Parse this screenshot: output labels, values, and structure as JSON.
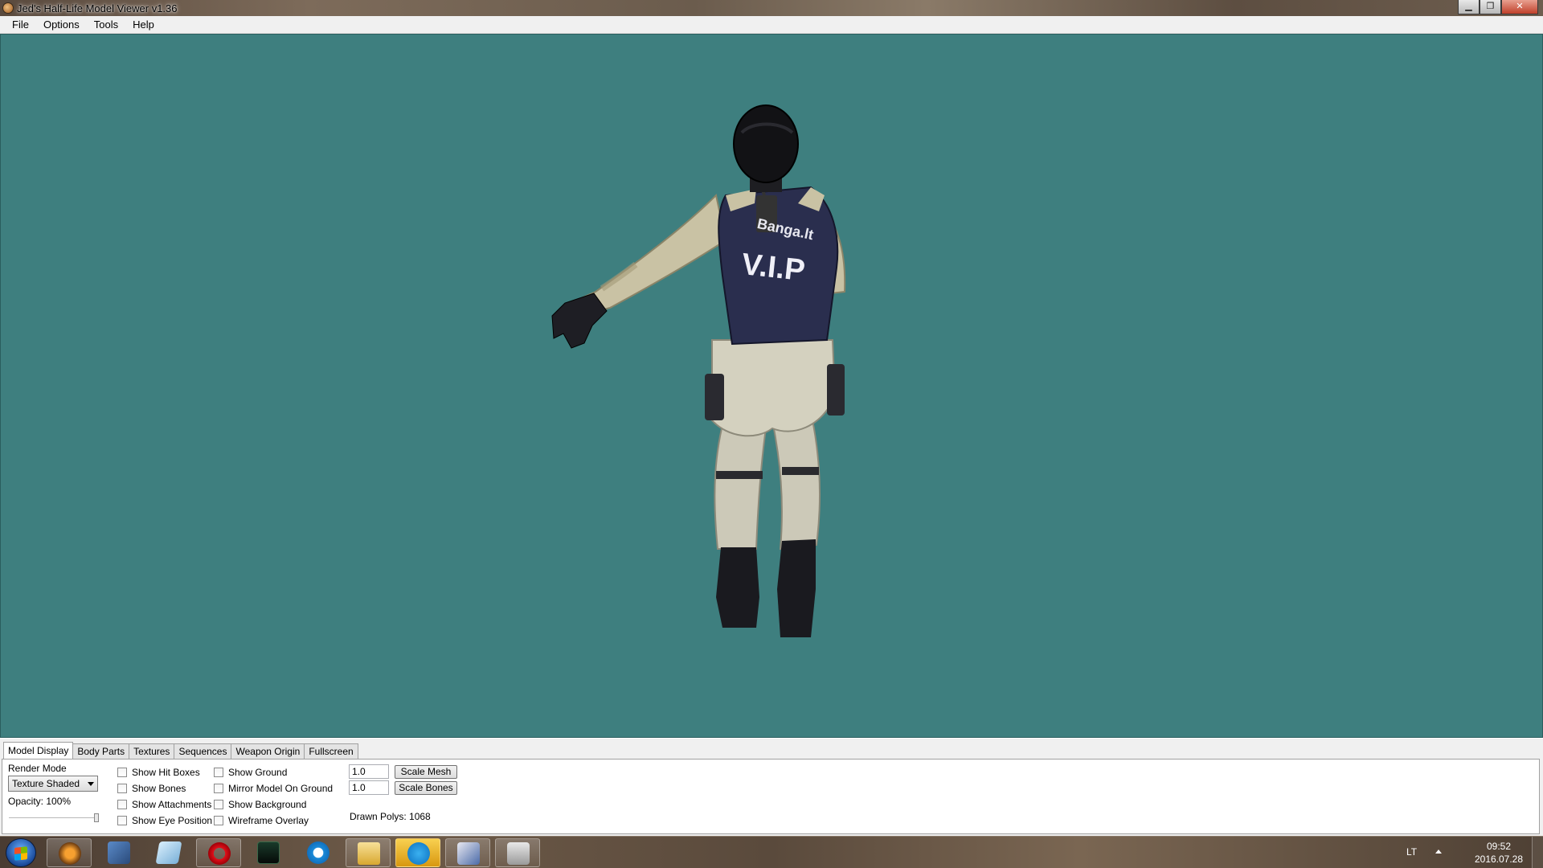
{
  "window": {
    "title": "Jed's Half-Life Model Viewer v1.36",
    "buttons": {
      "minimize": "▁",
      "maximize": "❐",
      "close": "✕"
    }
  },
  "menu": [
    "File",
    "Options",
    "Tools",
    "Help"
  ],
  "viewport": {
    "background": "#3e7f7f",
    "model_vest_text": "V.I.P",
    "model_vest_logo": "Banga.lt"
  },
  "tabs": [
    "Model Display",
    "Body Parts",
    "Textures",
    "Sequences",
    "Weapon Origin",
    "Fullscreen"
  ],
  "model_display": {
    "render_mode_label": "Render Mode",
    "render_mode_value": "Texture Shaded",
    "opacity_label": "Opacity: 100%",
    "opacity": 1.0,
    "checkboxes_col1": [
      "Show Hit Boxes",
      "Show Bones",
      "Show Attachments",
      "Show Eye Position"
    ],
    "checkboxes_col2": [
      "Show Ground",
      "Mirror Model On Ground",
      "Show Background",
      "Wireframe Overlay"
    ],
    "scale_mesh_value": "1.0",
    "scale_mesh_label": "Scale Mesh",
    "scale_bones_value": "1.0",
    "scale_bones_label": "Scale Bones",
    "drawn_polys": "Drawn Polys: 1068"
  },
  "taskbar": {
    "apps": [
      "half-life-icon",
      "network-icon",
      "notepad-icon",
      "opera-icon",
      "game-icon",
      "mail-icon",
      "explorer-icon",
      "skype-icon",
      "network-tool-icon",
      "counter-strike-icon"
    ],
    "language": "LT",
    "time": "09:52",
    "date": "2016.07.28"
  }
}
